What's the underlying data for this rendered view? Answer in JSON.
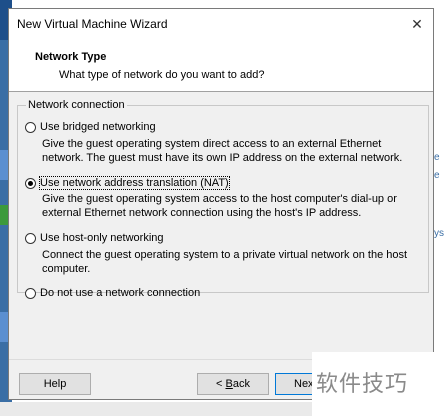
{
  "window": {
    "title": "New Virtual Machine Wizard",
    "close_glyph": "✕"
  },
  "header": {
    "title": "Network Type",
    "subtitle": "What type of network do you want to add?"
  },
  "group": {
    "label": "Network connection"
  },
  "options": [
    {
      "label": "Use bridged networking",
      "selected": false,
      "description": "Give the guest operating system direct access to an external Ethernet network. The guest must have its own IP address on the external network."
    },
    {
      "label": "Use network address translation (NAT)",
      "selected": true,
      "description": "Give the guest operating system access to the host computer's dial-up or external Ethernet network connection using the host's IP address."
    },
    {
      "label": "Use host-only networking",
      "selected": false,
      "description": "Connect the guest operating system to a private virtual network on the host computer."
    },
    {
      "label": "Do not use a network connection",
      "selected": false,
      "description": ""
    }
  ],
  "buttons": {
    "help": "Help",
    "back_prefix": "< ",
    "back_mnemonic": "B",
    "back_rest": "ack",
    "next_partial": "Nex"
  },
  "watermark": {
    "text": "软件技巧"
  },
  "background": {
    "right_glyphs": [
      "e",
      "e",
      "ys"
    ]
  }
}
